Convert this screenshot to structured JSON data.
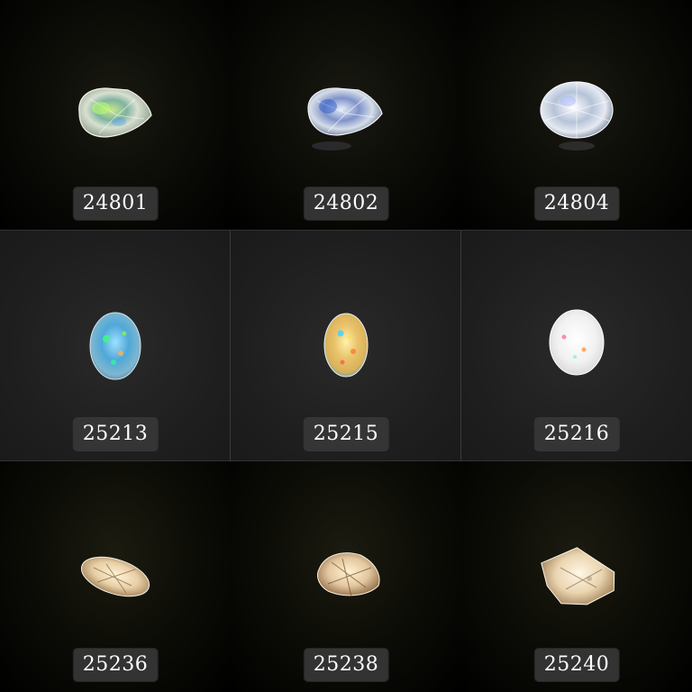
{
  "gallery": {
    "items": [
      {
        "id": "24801",
        "stone": "pear-faceted-stone-icon"
      },
      {
        "id": "24802",
        "stone": "pear-faceted-stone-icon"
      },
      {
        "id": "24804",
        "stone": "oval-faceted-stone-icon"
      },
      {
        "id": "25213",
        "stone": "oval-opal-cabochon-icon"
      },
      {
        "id": "25215",
        "stone": "oval-opal-cabochon-icon"
      },
      {
        "id": "25216",
        "stone": "oval-opal-cabochon-icon"
      },
      {
        "id": "25236",
        "stone": "oval-rutile-cabochon-icon"
      },
      {
        "id": "25238",
        "stone": "pear-rutile-cabochon-icon"
      },
      {
        "id": "25240",
        "stone": "freeform-rutile-stone-icon"
      }
    ]
  }
}
